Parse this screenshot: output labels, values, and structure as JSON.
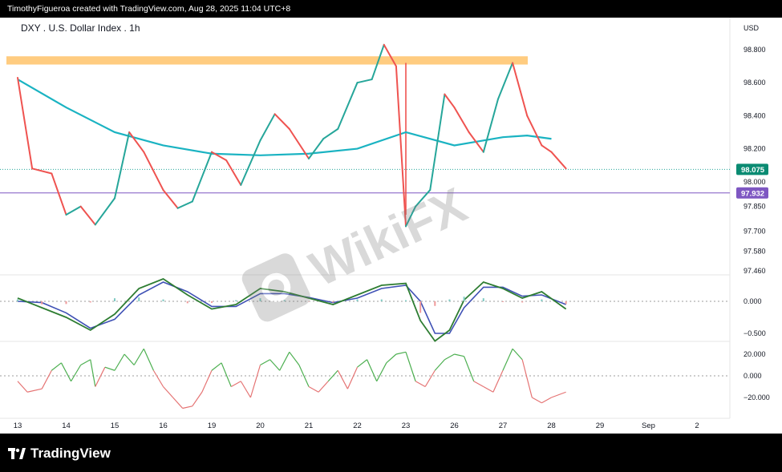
{
  "header": {
    "credit": "TimothyFigueroa created with TradingView.com, Aug 28, 2025 11:04 UTC+8"
  },
  "footer": {
    "brand": "TradingView"
  },
  "watermark": {
    "text": "WikiFX"
  },
  "colors": {
    "price_up": "#26a69a",
    "price_down": "#ef5350",
    "ma": "#1ab3c2",
    "resistance": "#ffcc80",
    "support_line": "#7e57c2",
    "current_badge": "#0a8b72",
    "support_badge": "#7e57c2",
    "macd_fast": "#2e7d32",
    "macd_signal": "#3f51b5",
    "rsi_up": "#4caf50",
    "rsi_down": "#e57373"
  },
  "chart_data": {
    "type": "line",
    "title": "DXY . U.S. Dollar Index . 1h",
    "currency": "USD",
    "price_axis_labels": [
      "98.800",
      "98.600",
      "98.400",
      "98.200",
      "98.000",
      "97.850",
      "97.700",
      "97.580",
      "97.460"
    ],
    "price_axis_values": [
      98.8,
      98.6,
      98.4,
      98.2,
      98.0,
      97.85,
      97.7,
      97.58,
      97.46
    ],
    "current_price": "98.075",
    "support_label": "97.932",
    "resistance_zone": [
      98.71,
      98.76
    ],
    "x_labels": [
      "13",
      "14",
      "15",
      "16",
      "19",
      "20",
      "21",
      "22",
      "23",
      "26",
      "27",
      "28",
      "29",
      "Sep",
      "2"
    ],
    "price_series": {
      "name": "",
      "x": [
        0,
        0.3,
        0.7,
        1.0,
        1.3,
        1.6,
        2.0,
        2.3,
        2.6,
        3.0,
        3.3,
        3.6,
        4.0,
        4.3,
        4.6,
        5.0,
        5.3,
        5.6,
        6.0,
        6.3,
        6.6,
        7.0,
        7.3,
        7.55,
        7.8,
        8.0,
        8.2,
        8.5,
        8.8,
        9.0,
        9.3,
        9.6,
        9.9,
        10.2,
        10.5,
        10.8,
        11.0,
        11.3
      ],
      "y": [
        98.63,
        98.08,
        98.05,
        97.8,
        97.85,
        97.74,
        97.9,
        98.3,
        98.18,
        97.95,
        97.84,
        97.88,
        98.18,
        98.13,
        97.98,
        98.25,
        98.41,
        98.32,
        98.14,
        98.26,
        98.32,
        98.6,
        98.62,
        98.83,
        98.7,
        97.73,
        97.85,
        97.95,
        98.53,
        98.45,
        98.3,
        98.18,
        98.5,
        98.72,
        98.4,
        98.22,
        98.18,
        98.08
      ]
    },
    "ma_series": {
      "name": "",
      "x": [
        0,
        1,
        2,
        3,
        4,
        5,
        6,
        7,
        8,
        9,
        10,
        10.5,
        11
      ],
      "y": [
        98.62,
        98.45,
        98.3,
        98.22,
        98.17,
        98.16,
        98.17,
        98.2,
        98.3,
        98.22,
        98.27,
        98.28,
        98.26
      ]
    },
    "macd_axis_labels": [
      "0.000",
      "−0.500"
    ],
    "macd_axis_values": [
      0,
      -0.5
    ],
    "macd_fast": {
      "x": [
        0,
        0.5,
        1,
        1.5,
        2,
        2.5,
        3,
        3.5,
        4,
        4.5,
        5,
        5.5,
        6,
        6.5,
        7,
        7.5,
        8,
        8.3,
        8.6,
        8.9,
        9.2,
        9.6,
        10,
        10.4,
        10.8,
        11.3
      ],
      "y": [
        0.05,
        -0.1,
        -0.25,
        -0.45,
        -0.2,
        0.2,
        0.35,
        0.1,
        -0.12,
        -0.05,
        0.2,
        0.15,
        0.05,
        -0.05,
        0.1,
        0.25,
        0.28,
        -0.3,
        -0.62,
        -0.45,
        0.02,
        0.3,
        0.2,
        0.05,
        0.15,
        -0.12
      ]
    },
    "macd_signal": {
      "x": [
        0,
        0.5,
        1,
        1.5,
        2,
        2.5,
        3,
        3.5,
        4,
        4.5,
        5,
        5.5,
        6,
        6.5,
        7,
        7.5,
        8,
        8.3,
        8.6,
        8.9,
        9.2,
        9.6,
        10,
        10.4,
        10.8,
        11.3
      ],
      "y": [
        0.0,
        -0.02,
        -0.18,
        -0.42,
        -0.28,
        0.1,
        0.3,
        0.15,
        -0.08,
        -0.08,
        0.12,
        0.12,
        0.06,
        -0.02,
        0.05,
        0.2,
        0.25,
        0.0,
        -0.5,
        -0.5,
        -0.1,
        0.22,
        0.22,
        0.08,
        0.1,
        -0.05
      ]
    },
    "rsi_axis_labels": [
      "20.000",
      "0.000",
      "−20.000"
    ],
    "rsi_axis_values": [
      20,
      0,
      -20
    ],
    "rsi_series": {
      "x": [
        0,
        0.2,
        0.5,
        0.7,
        0.9,
        1.1,
        1.3,
        1.5,
        1.6,
        1.8,
        2.0,
        2.2,
        2.4,
        2.6,
        2.8,
        3.0,
        3.2,
        3.4,
        3.6,
        3.8,
        4.0,
        4.2,
        4.4,
        4.6,
        4.8,
        5.0,
        5.2,
        5.4,
        5.6,
        5.8,
        6.0,
        6.2,
        6.4,
        6.6,
        6.8,
        7.0,
        7.2,
        7.4,
        7.6,
        7.8,
        8.0,
        8.2,
        8.4,
        8.6,
        8.8,
        9.0,
        9.2,
        9.4,
        9.6,
        9.8,
        10.0,
        10.2,
        10.4,
        10.6,
        10.8,
        11.0,
        11.3
      ],
      "y": [
        -5,
        -15,
        -12,
        5,
        12,
        -5,
        10,
        15,
        -10,
        8,
        5,
        20,
        10,
        25,
        5,
        -10,
        -20,
        -30,
        -28,
        -15,
        5,
        12,
        -10,
        -5,
        -20,
        10,
        15,
        5,
        22,
        10,
        -10,
        -15,
        -5,
        5,
        -12,
        8,
        15,
        -5,
        12,
        20,
        22,
        -5,
        -10,
        5,
        15,
        20,
        18,
        -5,
        -10,
        -15,
        5,
        25,
        15,
        -20,
        -25,
        -20,
        -15
      ]
    }
  }
}
